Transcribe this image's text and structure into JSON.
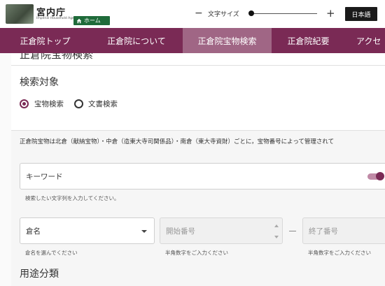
{
  "header": {
    "logo_title": "宮内庁",
    "logo_subtitle": "Imperial Household Agency",
    "home_label": "ホーム",
    "font_size_label": "文字サイズ",
    "minus_symbol": "−",
    "plus_symbol": "+",
    "language_button": "日本語"
  },
  "nav": {
    "items": [
      {
        "label": "正倉院トップ"
      },
      {
        "label": "正倉院について"
      },
      {
        "label": "正倉院宝物検索"
      },
      {
        "label": "正倉院紀要"
      },
      {
        "label": "アクセ"
      }
    ],
    "active_index": 2
  },
  "content": {
    "partial_heading": "正倉院宝物検索",
    "search_target_title": "検索対象",
    "radios": [
      {
        "label": "宝物検索",
        "checked": true
      },
      {
        "label": "文書検索",
        "checked": false
      }
    ],
    "intro_text": "正倉院宝物は北倉（献納宝物）・中倉（造東大寺司関係品）・南倉（東大寺資財）ごとに，宝物番号によって管理されて",
    "keyword": {
      "label": "キーワード",
      "hint": "検索したい文字列を入力してください。"
    },
    "storehouse": {
      "label": "倉名",
      "hint": "倉名を選んでください"
    },
    "start_number": {
      "placeholder": "開始番号",
      "hint": "半角数字をご入力ください"
    },
    "end_number": {
      "placeholder": "終了番号",
      "hint": "半角数字をご入力ください"
    },
    "usage_title": "用途分類"
  },
  "colors": {
    "brand": "#7a2a55",
    "nav_active": "#a06685",
    "home_green": "#1f6b3a"
  }
}
